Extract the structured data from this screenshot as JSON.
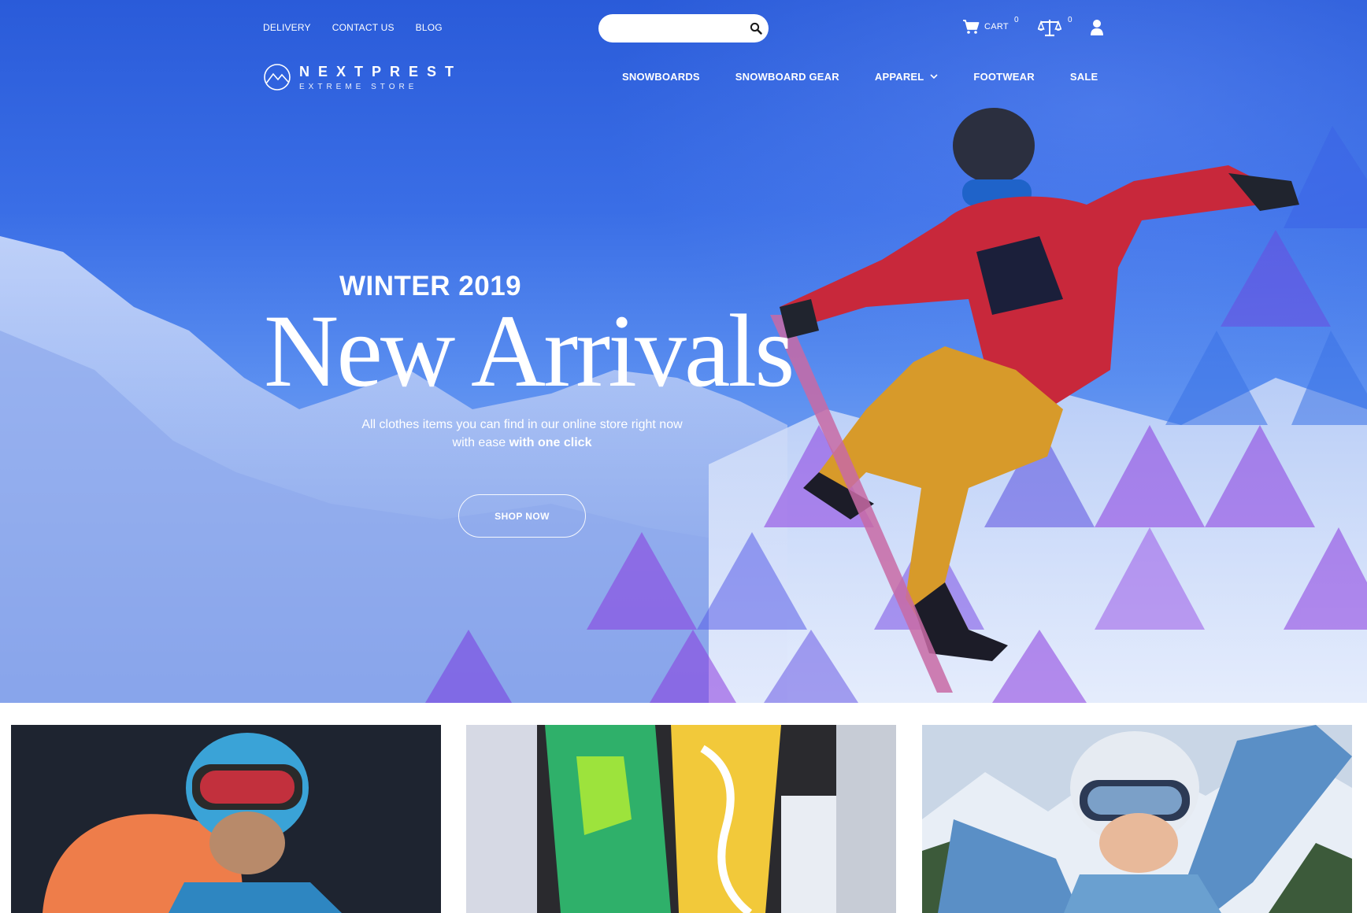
{
  "topbar": {
    "links": [
      {
        "label": "DELIVERY"
      },
      {
        "label": "CONTACT US"
      },
      {
        "label": "BLOG"
      }
    ],
    "search": {
      "placeholder": "",
      "value": ""
    },
    "cart": {
      "label": "CART",
      "count": "0"
    },
    "compare": {
      "count": "0"
    }
  },
  "logo": {
    "name": "NEXTPREST",
    "tagline": "EXTREME STORE"
  },
  "nav": {
    "items": [
      {
        "label": "SNOWBOARDS"
      },
      {
        "label": "SNOWBOARD GEAR"
      },
      {
        "label": "APPAREL"
      },
      {
        "label": "FOOTWEAR"
      },
      {
        "label": "SALE"
      }
    ]
  },
  "hero": {
    "subtitle": "WINTER 2019",
    "title": "New Arrivals",
    "desc_line1": "All clothes items you can find in our online store right now",
    "desc_line2_plain": "with ease ",
    "desc_line2_bold": "with one click",
    "cta": "SHOP NOW"
  },
  "icons": {
    "search": "search-icon",
    "cart": "cart-icon",
    "compare": "scales-icon",
    "user": "user-icon",
    "apparel_dropdown": "chevron-down-icon",
    "logo": "mountain-logo-icon"
  },
  "colors": {
    "hero_blue": "#2a5bd9",
    "accent_purple": "#8a3be0",
    "text_white": "#ffffff"
  }
}
